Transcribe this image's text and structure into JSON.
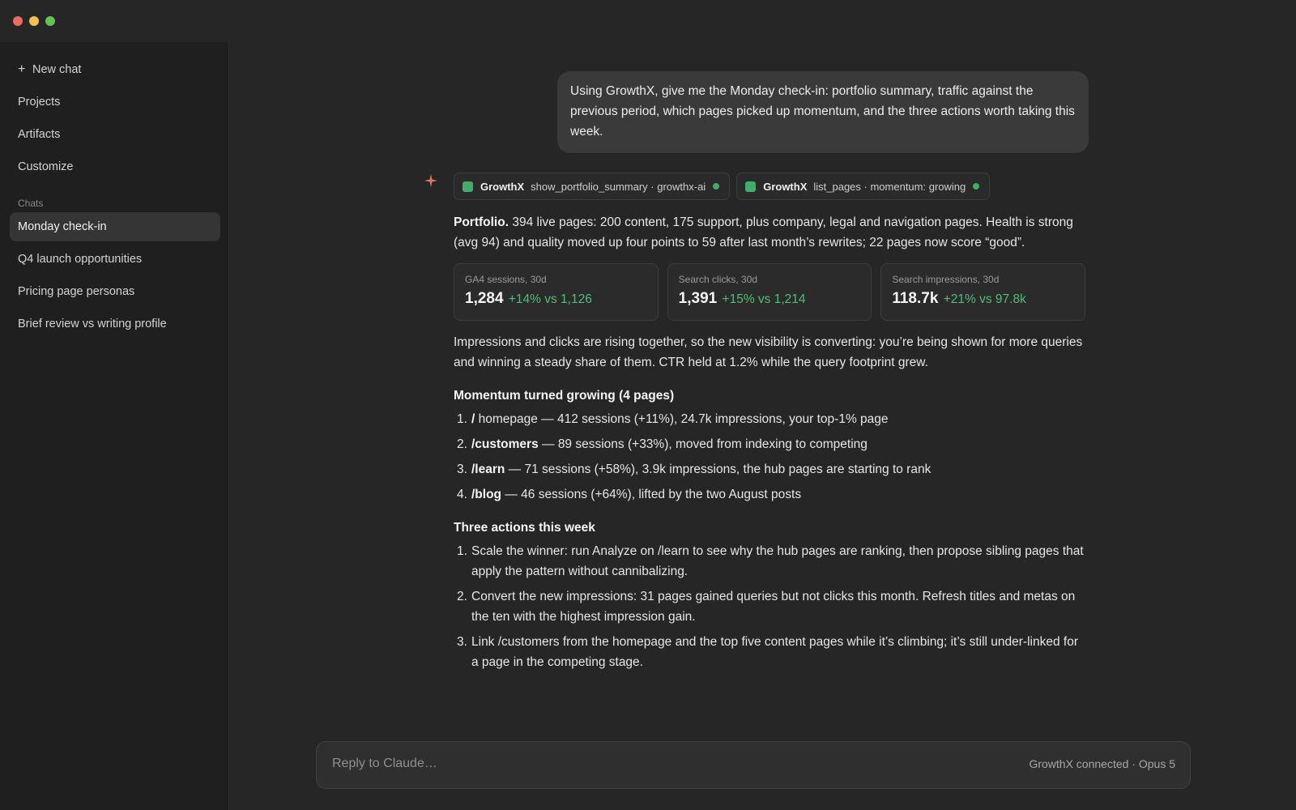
{
  "sidebar": {
    "new_chat": "New chat",
    "nav": [
      "Projects",
      "Artifacts",
      "Customize"
    ],
    "chats_label": "Chats",
    "chats": [
      "Monday check-in",
      "Q4 launch opportunities",
      "Pricing page personas",
      "Brief review vs writing profile"
    ],
    "active_chat": "Monday check-in"
  },
  "conversation": {
    "user_message": "Using GrowthX, give me the Monday check-in: portfolio summary, traffic against the previous period, which pages picked up momentum, and the three actions worth taking this week.",
    "tool_calls": [
      {
        "app": "GrowthX",
        "detail": "show_portfolio_summary · growthx-ai"
      },
      {
        "app": "GrowthX",
        "detail": "list_pages · momentum: growing"
      }
    ],
    "portfolio_lead": "Portfolio.",
    "portfolio_text": " 394 live pages: 200 content, 175 support, plus company, legal and navigation pages. Health is strong (avg 94) and quality moved up four points to 59 after last month’s rewrites; 22 pages now score “good”.",
    "stats": [
      {
        "label": "GA4 sessions, 30d",
        "value": "1,284",
        "delta": "+14% vs 1,126"
      },
      {
        "label": "Search clicks, 30d",
        "value": "1,391",
        "delta": "+15% vs 1,214"
      },
      {
        "label": "Search impressions, 30d",
        "value": "118.7k",
        "delta": "+21% vs 97.8k"
      }
    ],
    "impressions_text": "Impressions and clicks are rising together, so the new visibility is converting: you’re being shown for more queries and winning a steady share of them. CTR held at 1.2% while the query footprint grew.",
    "momentum_heading": "Momentum turned growing (4 pages)",
    "momentum": [
      {
        "num": "1.",
        "page": "/",
        "text": " homepage — 412 sessions (+11%), 24.7k impressions, your top-1% page"
      },
      {
        "num": "2.",
        "page": "/customers",
        "text": " — 89 sessions (+33%), moved from indexing to competing"
      },
      {
        "num": "3.",
        "page": "/learn",
        "text": " — 71 sessions (+58%), 3.9k impressions, the hub pages are starting to rank"
      },
      {
        "num": "4.",
        "page": "/blog",
        "text": " — 46 sessions (+64%), lifted by the two August posts"
      }
    ],
    "actions_heading": "Three actions this week",
    "actions": [
      {
        "num": "1.",
        "text": "Scale the winner: run Analyze on /learn to see why the hub pages are ranking, then propose sibling pages that apply the pattern without cannibalizing."
      },
      {
        "num": "2.",
        "text": "Convert the new impressions: 31 pages gained queries but not clicks this month. Refresh titles and metas on the ten with the highest impression gain."
      },
      {
        "num": "3.",
        "text": "Link /customers from the homepage and the top five content pages while it’s climbing; it’s still under-linked for a page in the competing stage."
      }
    ]
  },
  "composer": {
    "placeholder": "Reply to Claude…",
    "status": "GrowthX connected · Opus 5"
  },
  "colors": {
    "accent_green": "#4cbf7a",
    "spark": "#e0765a",
    "background": "#262626",
    "sidebar": "#1f1f1f"
  }
}
